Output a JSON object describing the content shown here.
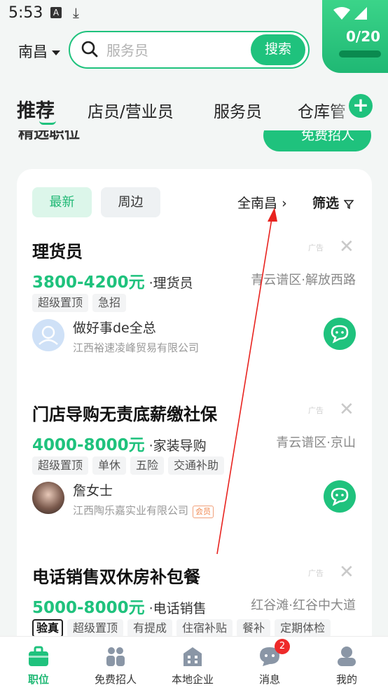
{
  "status_bar": {
    "time": "5:53",
    "a_icon": "A"
  },
  "timer": {
    "text": "0/20"
  },
  "location": {
    "city": "南昌"
  },
  "search": {
    "placeholder": "服务员",
    "button_label": "搜索"
  },
  "tabs": [
    {
      "label": "推荐",
      "active": true
    },
    {
      "label": "店员/营业员"
    },
    {
      "label": "服务员"
    },
    {
      "label": "仓库管"
    }
  ],
  "peek": {
    "title": "精选职位",
    "button_label": "免费招人"
  },
  "filters": {
    "chip_new": "最新",
    "chip_near": "周边",
    "city": "全南昌",
    "screen": "筛选"
  },
  "jobs": [
    {
      "title": "理货员",
      "ad": "广告",
      "salary": "3800-4200元",
      "role": "·理货员",
      "location": "青云谱区·解放西路",
      "tags": [
        "超级置顶",
        "急招"
      ],
      "contact": "做好事de全总",
      "company": "江西裕速凌峰贸易有限公司"
    },
    {
      "title": "门店导购无责底薪缴社保",
      "ad": "广告",
      "salary": "4000-8000元",
      "role": "·家装导购",
      "location": "青云谱区·京山",
      "tags": [
        "超级置顶",
        "单休",
        "五险",
        "交通补助"
      ],
      "contact": "詹女士",
      "company": "江西陶乐嘉实业有限公司",
      "member_badge": "会员"
    },
    {
      "title": "电话销售双休房补包餐",
      "ad": "广告",
      "salary": "5000-8000元",
      "role": "·电话销售",
      "location": "红谷滩·红谷中大道",
      "verified_tag": "验真",
      "tags": [
        "超级置顶",
        "有提成",
        "住宿补贴",
        "餐补",
        "定期体检"
      ]
    }
  ],
  "bottom_nav": [
    {
      "label": "职位",
      "icon": "briefcase-icon",
      "active": true
    },
    {
      "label": "免费招人",
      "icon": "people-icon"
    },
    {
      "label": "本地企业",
      "icon": "building-icon"
    },
    {
      "label": "消息",
      "icon": "chat-icon",
      "badge": "2"
    },
    {
      "label": "我的",
      "icon": "profile-icon"
    }
  ],
  "colors": {
    "accent": "#1fc27d",
    "annotation_arrow": "#e8231f",
    "badge": "#ee2a2a"
  }
}
